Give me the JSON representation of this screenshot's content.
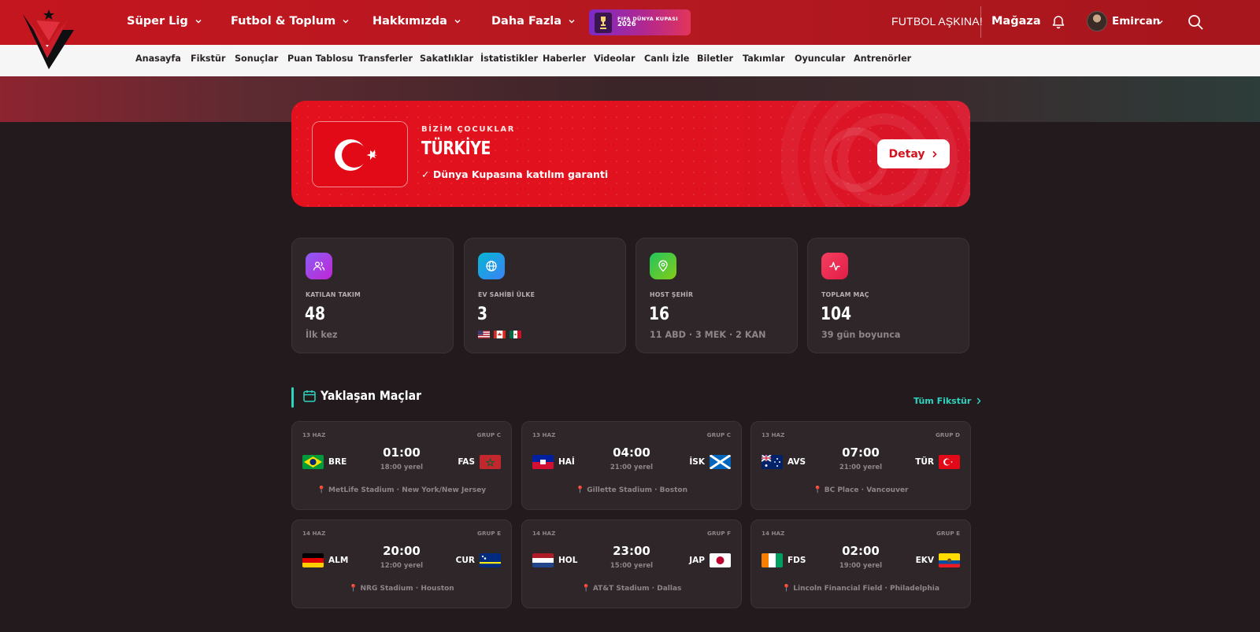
{
  "header": {
    "nav": [
      {
        "label": "Süper Lig"
      },
      {
        "label": "Futbol & Toplum"
      },
      {
        "label": "Hakkımızda"
      },
      {
        "label": "Daha Fazla"
      }
    ],
    "world_cup_badge": {
      "line1": "FIFA DÜNYA KUPASI",
      "line2": "2026"
    },
    "slogan": "FUTBOL AŞKINA!",
    "store": "Mağaza",
    "user": {
      "name": "Emircan"
    },
    "colors": {
      "primary": "#c4161f",
      "accent": "#2dd4bf"
    }
  },
  "subnav": [
    "Anasayfa",
    "Fikstür",
    "Sonuçlar",
    "Puan Tablosu",
    "Transferler",
    "Sakatlıklar",
    "İstatistikler",
    "Haberler",
    "Videolar",
    "Canlı İzle",
    "Biletler",
    "Takımlar",
    "Oyuncular",
    "Antrenörler"
  ],
  "banner": {
    "kicker": "BİZİM ÇOCUKLAR",
    "country": "TÜRKİYE",
    "note": "✓ Dünya Kupasına katılım garanti",
    "button": "Detay"
  },
  "stats": [
    {
      "label": "KATILAN TAKIM",
      "value": "48",
      "sub": "İlk kez",
      "icon": "users-icon"
    },
    {
      "label": "EV SAHİBİ ÜLKE",
      "value": "3",
      "sub": "",
      "icon": "globe-icon",
      "flags": [
        "us",
        "ca",
        "mx"
      ]
    },
    {
      "label": "HOST ŞEHİR",
      "value": "16",
      "sub": "11 ABD · 3 MEK · 2 KAN",
      "icon": "map-pin-icon"
    },
    {
      "label": "TOPLAM MAÇ",
      "value": "104",
      "sub": "39 gün boyunca",
      "icon": "activity-icon"
    }
  ],
  "upcoming": {
    "title": "Yaklaşan Maçlar",
    "all_link": "Tüm Fikstür",
    "matches": [
      {
        "date": "13 HAZ",
        "group": "GRUP C",
        "home": "BRE",
        "away": "FAS",
        "time": "01:00",
        "local": "18:00 yerel",
        "venue": "MetLife Stadium · New York/New Jersey"
      },
      {
        "date": "13 HAZ",
        "group": "GRUP C",
        "home": "HAİ",
        "away": "İSK",
        "time": "04:00",
        "local": "21:00 yerel",
        "venue": "Gillette Stadium · Boston"
      },
      {
        "date": "13 HAZ",
        "group": "GRUP D",
        "home": "AVS",
        "away": "TÜR",
        "time": "07:00",
        "local": "21:00 yerel",
        "venue": "BC Place · Vancouver"
      },
      {
        "date": "14 HAZ",
        "group": "GRUP E",
        "home": "ALM",
        "away": "CUR",
        "time": "20:00",
        "local": "12:00 yerel",
        "venue": "NRG Stadium · Houston"
      },
      {
        "date": "14 HAZ",
        "group": "GRUP F",
        "home": "HOL",
        "away": "JAP",
        "time": "23:00",
        "local": "15:00 yerel",
        "venue": "AT&T Stadium · Dallas"
      },
      {
        "date": "14 HAZ",
        "group": "GRUP E",
        "home": "FDS",
        "away": "EKV",
        "time": "02:00",
        "local": "19:00 yerel",
        "venue": "Lincoln Financial Field · Philadelphia"
      }
    ]
  }
}
